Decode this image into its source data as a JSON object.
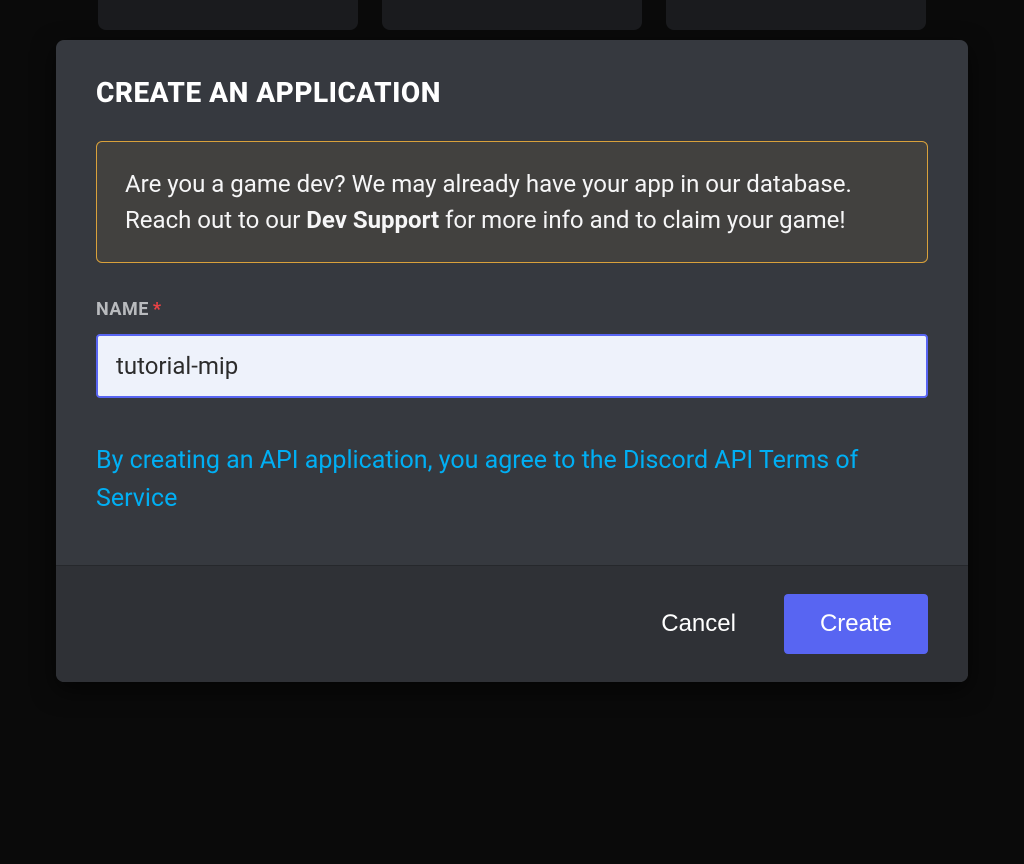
{
  "modal": {
    "title": "CREATE AN APPLICATION",
    "alert": {
      "prefix": "Are you a game dev? We may already have your app in our database. Reach out to our ",
      "bold": "Dev Support",
      "suffix": " for more info and to claim your game!"
    },
    "name_field": {
      "label": "NAME",
      "required_mark": "*",
      "value": "tutorial-mip"
    },
    "tos_text": "By creating an API application, you agree to the Discord API Terms of Service",
    "footer": {
      "cancel_label": "Cancel",
      "create_label": "Create"
    }
  }
}
